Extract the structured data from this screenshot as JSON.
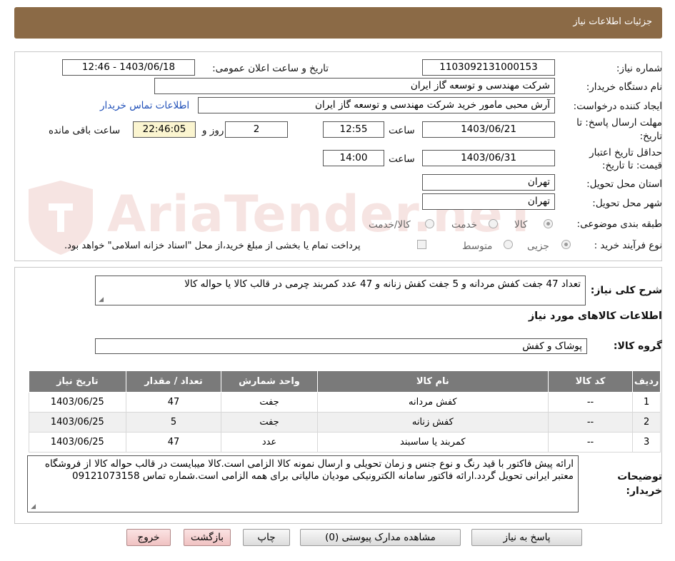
{
  "header": {
    "title": "جزئیات اطلاعات نیاز"
  },
  "fields": {
    "need_number_label": "شماره نیاز:",
    "need_number": "1103092131000153",
    "announce_label": "تاریخ و ساعت اعلان عمومی:",
    "announce_value": "1403/06/18 - 12:46",
    "buyer_org_label": "نام دستگاه خریدار:",
    "buyer_org": "شرکت مهندسی و توسعه گاز ایران",
    "creator_label": "ایجاد کننده درخواست:",
    "creator": "آرش محبی مامور خرید شرکت مهندسی و توسعه گاز ایران",
    "contact_link": "اطلاعات تماس خریدار",
    "deadline_label_1": "مهلت ارسال پاسخ: تا",
    "deadline_label_2": "تاریخ:",
    "deadline_date": "1403/06/21",
    "time_label": "ساعت",
    "deadline_time": "12:55",
    "days_value": "2",
    "days_label": "روز و",
    "remaining_time": "22:46:05",
    "remaining_label": "ساعت باقی مانده",
    "validity_label_1": "حداقل تاریخ اعتبار",
    "validity_label_2": "قیمت: تا تاریخ:",
    "validity_date": "1403/06/31",
    "validity_time": "14:00",
    "province_label": "استان محل تحویل:",
    "province": "تهران",
    "city_label": "شهر محل تحویل:",
    "city": "تهران",
    "category_label": "طبقه بندی موضوعی:",
    "category_options": [
      "کالا",
      "خدمت",
      "کالا/خدمت"
    ],
    "process_label": "نوع فرآیند خرید :",
    "process_options": [
      "جزیی",
      "متوسط"
    ],
    "payment_note": "پرداخت تمام یا بخشی از مبلغ خرید،از محل \"اسناد خزانه اسلامی\" خواهد بود."
  },
  "summary": {
    "label": "شرح کلی نیاز:",
    "text": "تعداد 47 جفت کفش مردانه و 5 جفت کفش زنانه و 47 عدد کمربند چرمی در قالب کالا یا حواله کالا",
    "goods_info_title": "اطلاعات کالاهای مورد نیاز",
    "goods_group_label": "گروه کالا:",
    "goods_group": "پوشاک و کفش"
  },
  "table": {
    "headers": [
      "ردیف",
      "کد کالا",
      "نام کالا",
      "واحد شمارش",
      "تعداد / مقدار",
      "تاریخ نیاز"
    ],
    "rows": [
      [
        "1",
        "--",
        "کفش مردانه",
        "جفت",
        "47",
        "1403/06/25"
      ],
      [
        "2",
        "--",
        "کفش زنانه",
        "جفت",
        "5",
        "1403/06/25"
      ],
      [
        "3",
        "--",
        "کمربند یا ساسبند",
        "عدد",
        "47",
        "1403/06/25"
      ]
    ]
  },
  "buyer_notes": {
    "label_1": "توضیحات",
    "label_2": "خریدار:",
    "text": "ارائه پیش فاکتور با قید رنگ و نوع جنس و زمان تحویلی و ارسال نمونه کالا الزامی است.کالا میبایست در قالب حواله کالا از فروشگاه معتبر ایرانی تحویل گردد.ارائه فاکتور سامانه الکترونیکی مودیان مالیاتی برای همه الزامی است.شماره تماس 09121073158"
  },
  "buttons": {
    "reply": "پاسخ به نیاز",
    "attachments": "مشاهده مدارک پیوستی (0)",
    "print": "چاپ",
    "back": "بازگشت",
    "exit": "خروج"
  },
  "watermark": {
    "text": "AriaTender.neT",
    "color": "#c0392b"
  }
}
